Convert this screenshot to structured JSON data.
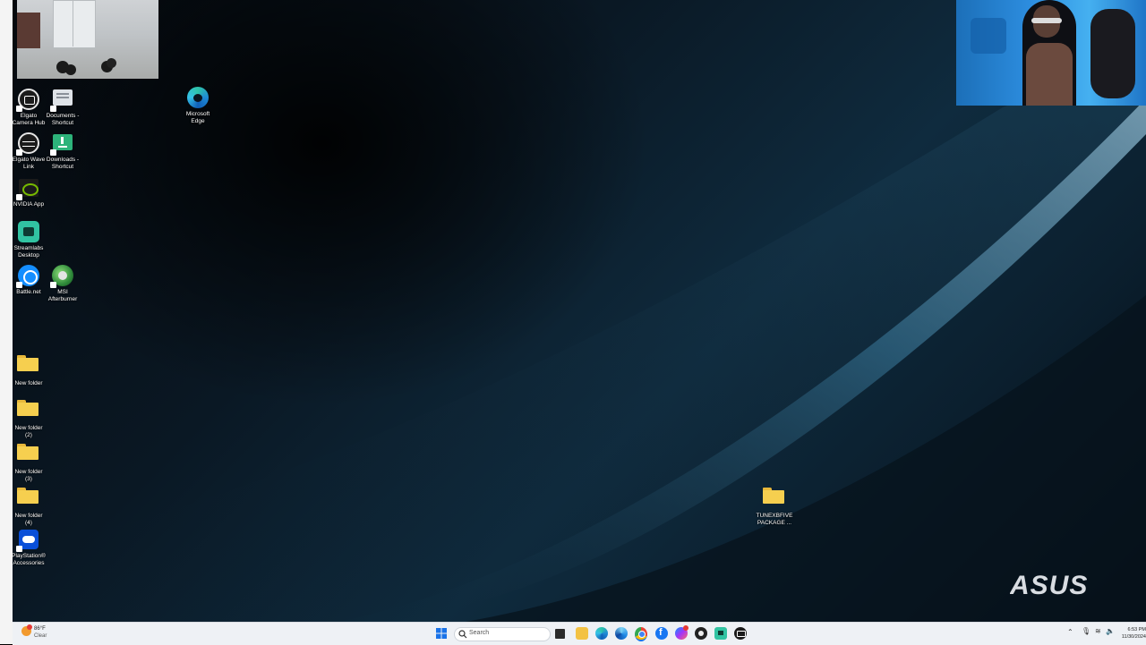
{
  "desktop_icons": [
    {
      "label": "Elgato\nCamera Hub",
      "icon": "elgato-camera-hub-icon"
    },
    {
      "label": "Documents -\nShortcut",
      "icon": "documents-shortcut-icon"
    },
    {
      "label": "Microsoft\nEdge",
      "icon": "edge-icon"
    },
    {
      "label": "Elgato Wave\nLink",
      "icon": "elgato-wave-link-icon"
    },
    {
      "label": "Downloads -\nShortcut",
      "icon": "downloads-shortcut-icon"
    },
    {
      "label": "NVIDIA App",
      "icon": "nvidia-icon"
    },
    {
      "label": "Streamlabs\nDesktop",
      "icon": "streamlabs-icon"
    },
    {
      "label": "Battle.net",
      "icon": "battlenet-icon"
    },
    {
      "label": "MSI\nAfterburner",
      "icon": "msi-afterburner-icon"
    },
    {
      "label": "New folder",
      "icon": "folder-icon"
    },
    {
      "label": "New folder\n(2)",
      "icon": "folder-icon"
    },
    {
      "label": "New folder\n(3)",
      "icon": "folder-icon"
    },
    {
      "label": "New folder\n(4)",
      "icon": "folder-icon"
    },
    {
      "label": "PlayStation®\nAccessories",
      "icon": "playstation-accessories-icon"
    },
    {
      "label": "TUNEXBFIVE\nPACKAGE ...",
      "icon": "folder-icon"
    }
  ],
  "brand_logo": "ASUS",
  "taskbar": {
    "weather": {
      "temperature": "86°F",
      "condition": "Clear"
    },
    "search_placeholder": "Search",
    "pinned_apps": [
      "start",
      "search",
      "task-view",
      "file-explorer",
      "edge",
      "edge-dev",
      "chrome",
      "facebook",
      "messenger",
      "obs",
      "streamlabs",
      "elgato"
    ],
    "clock": {
      "time": "6:53 PM",
      "date": "11/30/2024"
    }
  },
  "colors": {
    "taskbar_bg": "#eef1f5",
    "wallpaper_dark": "#05080c",
    "wallpaper_accent": "#2a6a8e",
    "folder": "#f6cf4f"
  }
}
